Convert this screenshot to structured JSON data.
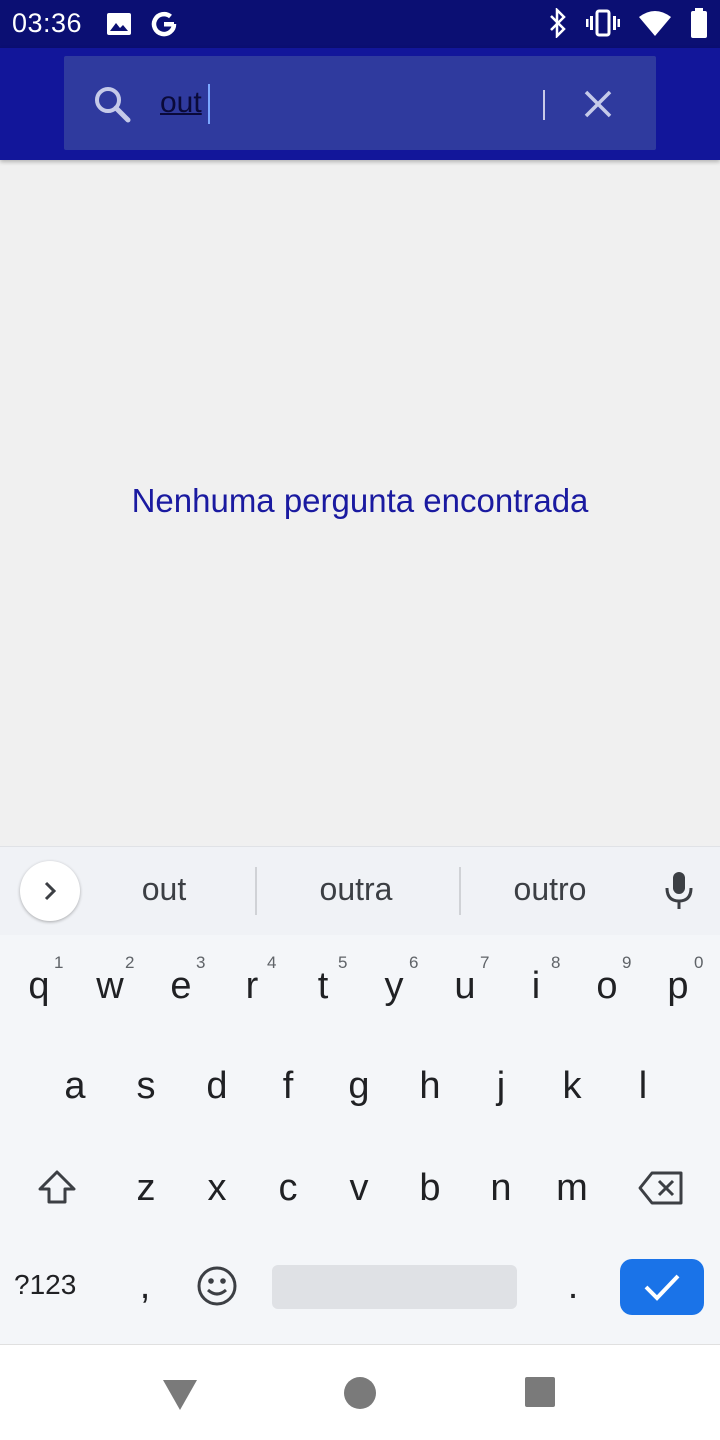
{
  "status_bar": {
    "time": "03:36",
    "left_icons": [
      "image-icon",
      "google-g-icon"
    ],
    "right_icons": [
      "bluetooth-icon",
      "vibrate-icon",
      "wifi-icon",
      "battery-icon"
    ]
  },
  "search": {
    "value": "out"
  },
  "empty_state": {
    "message": "Nenhuma pergunta encontrada"
  },
  "keyboard": {
    "suggestions": [
      "out",
      "outra",
      "outro"
    ],
    "row1": [
      "q",
      "w",
      "e",
      "r",
      "t",
      "y",
      "u",
      "i",
      "o",
      "p"
    ],
    "row1_hints": [
      "1",
      "2",
      "3",
      "4",
      "5",
      "6",
      "7",
      "8",
      "9",
      "0"
    ],
    "row2": [
      "a",
      "s",
      "d",
      "f",
      "g",
      "h",
      "j",
      "k",
      "l"
    ],
    "row3": [
      "z",
      "x",
      "c",
      "v",
      "b",
      "n",
      "m"
    ],
    "symbols_label": "?123",
    "comma": ",",
    "period": "."
  },
  "colors": {
    "status_bar": "#0b0f73",
    "app_bar": "#12169a",
    "search_box": "#2f3a9e",
    "message": "#1a1aa0",
    "enter_key": "#1a73e8"
  }
}
